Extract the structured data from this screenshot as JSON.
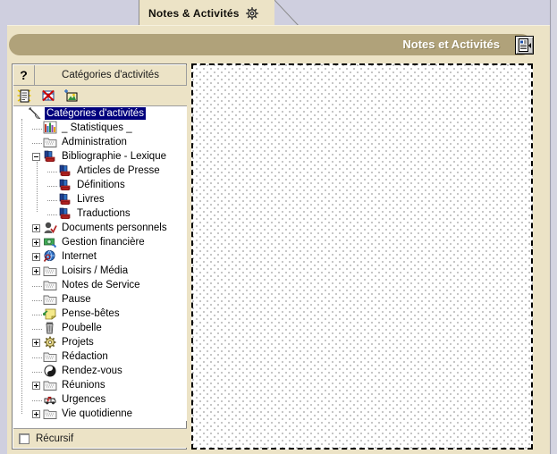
{
  "window": {
    "tab_label": "Notes & Activités",
    "tab_icon": "gear-icon",
    "title": "Notes et Activités",
    "title_button_icon": "list-view-icon"
  },
  "tree_panel": {
    "help_button": "?",
    "header_title": "Catégories d'activités",
    "toolbar": [
      {
        "name": "new-note-icon",
        "tooltip": "Nouvelle note"
      },
      {
        "name": "delete-icon",
        "tooltip": "Supprimer"
      },
      {
        "name": "new-image-icon",
        "tooltip": "Nouvelle image"
      }
    ],
    "footer": {
      "recursive_label": "Récursif",
      "recursive_checked": false
    },
    "items": [
      {
        "label": "Catégories d'activités",
        "depth": 0,
        "icon": "pen-icon",
        "expander": "none",
        "selected": true
      },
      {
        "label": "_ Statistiques _",
        "depth": 1,
        "icon": "chart-icon",
        "expander": "none",
        "selected": false
      },
      {
        "label": "Administration",
        "depth": 1,
        "icon": "folder-icon",
        "expander": "none",
        "selected": false
      },
      {
        "label": "Bibliographie - Lexique",
        "depth": 1,
        "icon": "books-icon",
        "expander": "minus",
        "selected": false
      },
      {
        "label": "Articles de Presse",
        "depth": 2,
        "icon": "books-icon",
        "expander": "none",
        "selected": false
      },
      {
        "label": "Définitions",
        "depth": 2,
        "icon": "books-icon",
        "expander": "none",
        "selected": false
      },
      {
        "label": "Livres",
        "depth": 2,
        "icon": "books-icon",
        "expander": "none",
        "selected": false
      },
      {
        "label": "Traductions",
        "depth": 2,
        "icon": "books-icon",
        "expander": "none",
        "selected": false
      },
      {
        "label": "Documents personnels",
        "depth": 1,
        "icon": "person-check-icon",
        "expander": "plus",
        "selected": false
      },
      {
        "label": "Gestion financière",
        "depth": 1,
        "icon": "money-icon",
        "expander": "plus",
        "selected": false
      },
      {
        "label": "Internet",
        "depth": 1,
        "icon": "globe-icon",
        "expander": "plus",
        "selected": false
      },
      {
        "label": "Loisirs / Média",
        "depth": 1,
        "icon": "folder-icon",
        "expander": "plus",
        "selected": false
      },
      {
        "label": "Notes de Service",
        "depth": 1,
        "icon": "folder-icon",
        "expander": "none",
        "selected": false
      },
      {
        "label": "Pause",
        "depth": 1,
        "icon": "folder-icon",
        "expander": "none",
        "selected": false
      },
      {
        "label": "Pense-bêtes",
        "depth": 1,
        "icon": "note-pin-icon",
        "expander": "none",
        "selected": false
      },
      {
        "label": "Poubelle",
        "depth": 1,
        "icon": "trash-icon",
        "expander": "none",
        "selected": false
      },
      {
        "label": "Projets",
        "depth": 1,
        "icon": "gear-icon",
        "expander": "plus",
        "selected": false
      },
      {
        "label": "Rédaction",
        "depth": 1,
        "icon": "folder-icon",
        "expander": "none",
        "selected": false
      },
      {
        "label": "Rendez-vous",
        "depth": 1,
        "icon": "yinyang-icon",
        "expander": "none",
        "selected": false
      },
      {
        "label": "Réunions",
        "depth": 1,
        "icon": "folder-icon",
        "expander": "plus",
        "selected": false
      },
      {
        "label": "Urgences",
        "depth": 1,
        "icon": "ambulance-icon",
        "expander": "none",
        "selected": false
      },
      {
        "label": "Vie quotidienne",
        "depth": 1,
        "icon": "folder-icon",
        "expander": "plus",
        "selected": false
      }
    ]
  },
  "content_area": {
    "description": "empty dotted pattern canvas"
  },
  "colors": {
    "panel_beige": "#ece3c6",
    "title_pill": "#b0a27a",
    "tab_background": "#ece3c6",
    "window_backdrop": "#cfcfdf",
    "selection_blue": "#00007d"
  }
}
